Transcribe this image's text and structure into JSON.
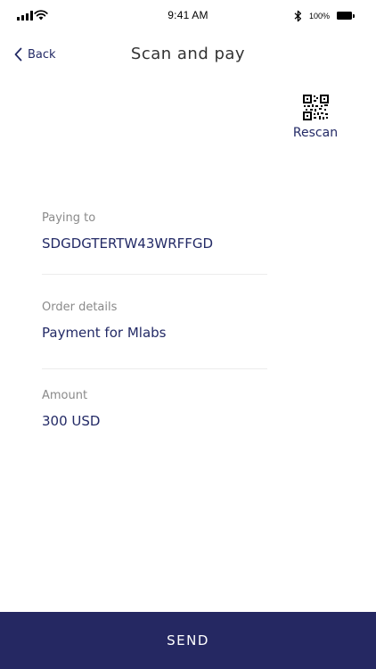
{
  "status_bar": {
    "time": "9:41 AM",
    "battery_percent": "100%",
    "icons": [
      "signal-icon",
      "wifi-icon",
      "bluetooth-icon",
      "battery-icon"
    ]
  },
  "nav": {
    "back_label": "Back",
    "back_icon": "chevron-left-icon",
    "title": "Scan and pay"
  },
  "rescan": {
    "label": "Rescan",
    "icon": "qr-code-icon"
  },
  "details": [
    {
      "label": "Paying to",
      "value": "SDGDGTERTW43WRFFGD"
    },
    {
      "label": "Order details",
      "value": "Payment for Mlabs"
    },
    {
      "label": "Amount",
      "value": "300 USD"
    }
  ],
  "send": {
    "label": "SEND"
  },
  "colors": {
    "accent": "#232a66",
    "button_bg": "#252862",
    "label_grey": "#8a8a8a",
    "divider": "#ececec"
  }
}
